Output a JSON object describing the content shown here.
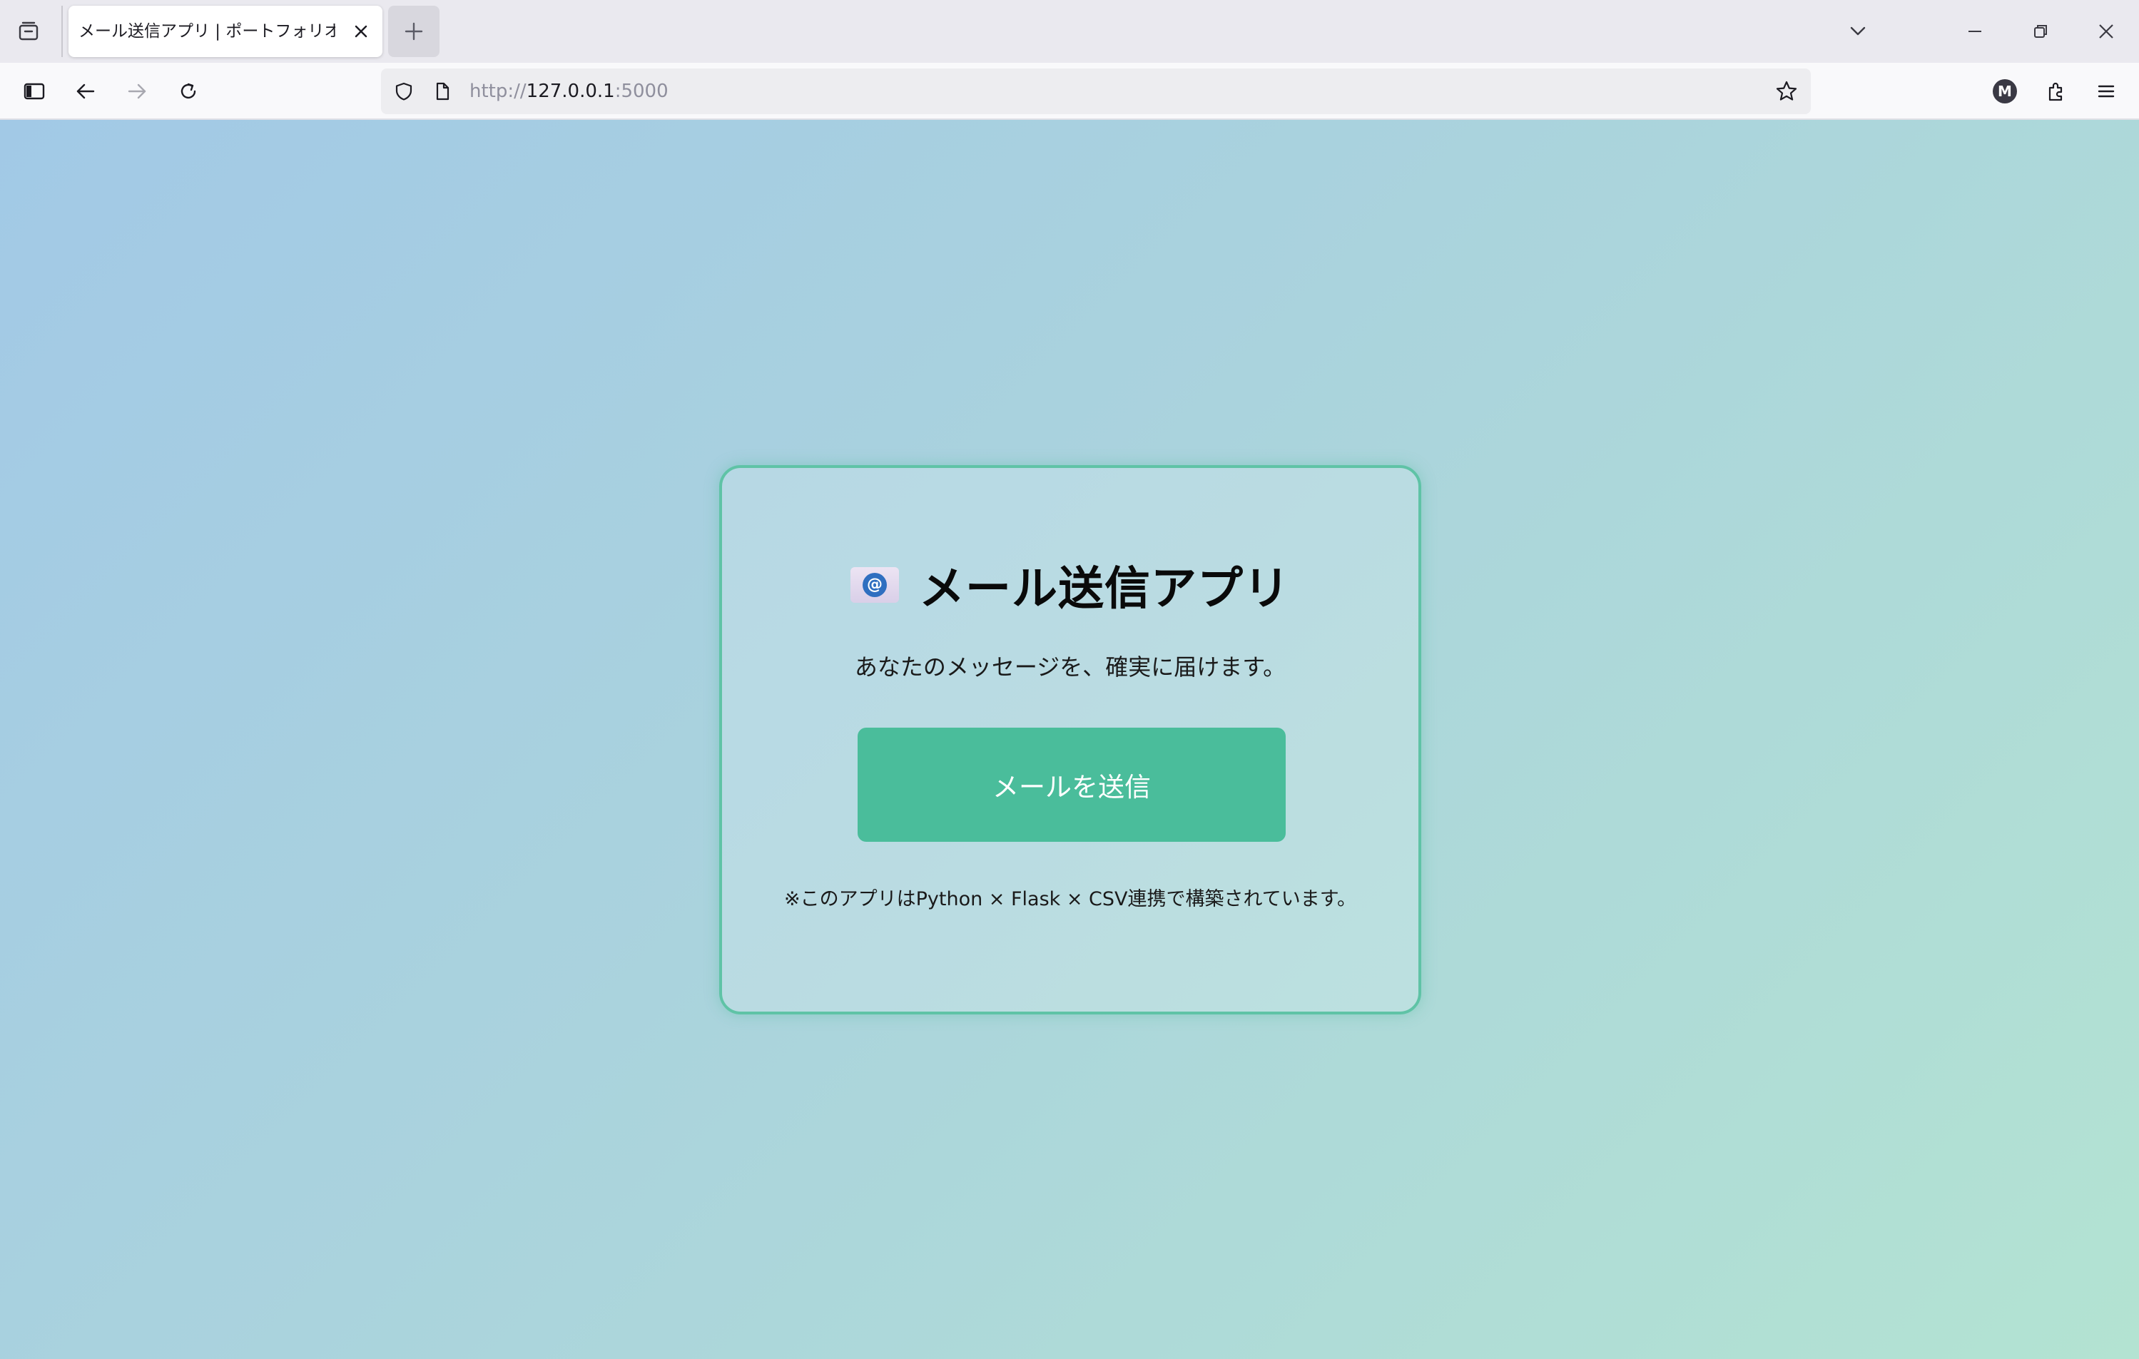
{
  "browser": {
    "tab_title": "メール送信アプリ | ポートフォリオ",
    "url_scheme": "http://",
    "url_host": "127.0.0.1",
    "url_port": ":5000",
    "account_initial": "M"
  },
  "icons": {
    "tab_list": "tab-list-icon",
    "close_tab": "close-icon",
    "new_tab": "plus-icon",
    "list_all_tabs": "chevron-down-icon",
    "minimize": "minimize-icon",
    "restore": "restore-icon",
    "close_window": "close-icon",
    "sidebar": "sidebar-icon",
    "back": "arrow-left-icon",
    "forward": "arrow-right-icon",
    "reload": "reload-icon",
    "tracking_protection": "shield-icon",
    "page_info": "document-icon",
    "bookmark": "star-icon",
    "extensions": "puzzle-icon",
    "menu": "hamburger-menu-icon",
    "app_logo": "mail-at-icon"
  },
  "page": {
    "title": "メール送信アプリ",
    "subtitle": "あなたのメッセージを、確実に届けます。",
    "send_button_label": "メールを送信",
    "footnote": "※このアプリはPython × Flask × CSV連携で構築されています。"
  },
  "colors": {
    "accent": "#4abd9b",
    "card_border": "#5fc3a6",
    "background_start": "#a2c9e6",
    "background_end": "#b3e3d2"
  }
}
